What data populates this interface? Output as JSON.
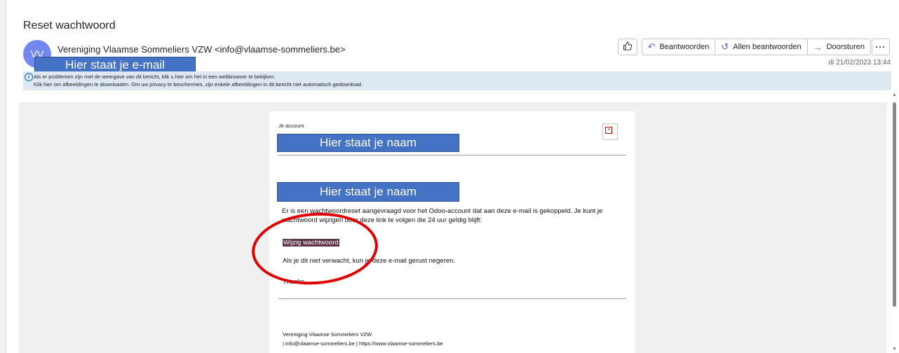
{
  "email": {
    "subject": "Reset wachtwoord",
    "avatar_initials": "VV",
    "sender": "Vereniging Vlaamse Sommeliers VZW <info@vlaamse-sommeliers.be>",
    "redacted_email_label": "Hier staat je e-mail",
    "date": "di 21/02/2023 13:44"
  },
  "toolbar": {
    "like_icon": "thumbs-up-icon",
    "reply_label": "Beantwoorden",
    "reply_all_label": "Allen beantwoorden",
    "forward_label": "Doorsturen",
    "more_label": "···"
  },
  "info_bar": {
    "line1": "Als er problemen zijn met de weergave van dit bericht, klik u hier om het in een webbrowser te bekijken.",
    "line2": "Klik hier om afbeeldingen te downloaden. Om uw privacy te beschermen, zijn enkele afbeeldingen in dit bericht niet automatisch gedownload."
  },
  "message": {
    "account_label": "Je account",
    "redacted_name_label": "Hier staat je naam",
    "redacted_name_label_2": "Hier staat je naam",
    "body": "Er is een wachtwoordreset aangevraagd voor het Odoo-account dat aan deze e-mail is gekoppeld. Je kunt je wachtwoord wijzigen door deze link te volgen die 24 uur geldig blijft:",
    "link_label": "Wijzig wachtwoord",
    "ignore_text": "Als je dit niet verwacht, kun je deze e-mail gerust negeren.",
    "thanks": "Thanks,",
    "footer_name": "Vereniging Vlaamse Sommeliers VZW",
    "footer_contact": "| info@vlaamse-sommeliers.be | https://www.vlaamse-sommeliers.be"
  },
  "colors": {
    "redaction_box": "#4472c4",
    "highlight_circle": "#e00000",
    "link_background": "#5c3349",
    "info_bar": "#dde8f3"
  }
}
